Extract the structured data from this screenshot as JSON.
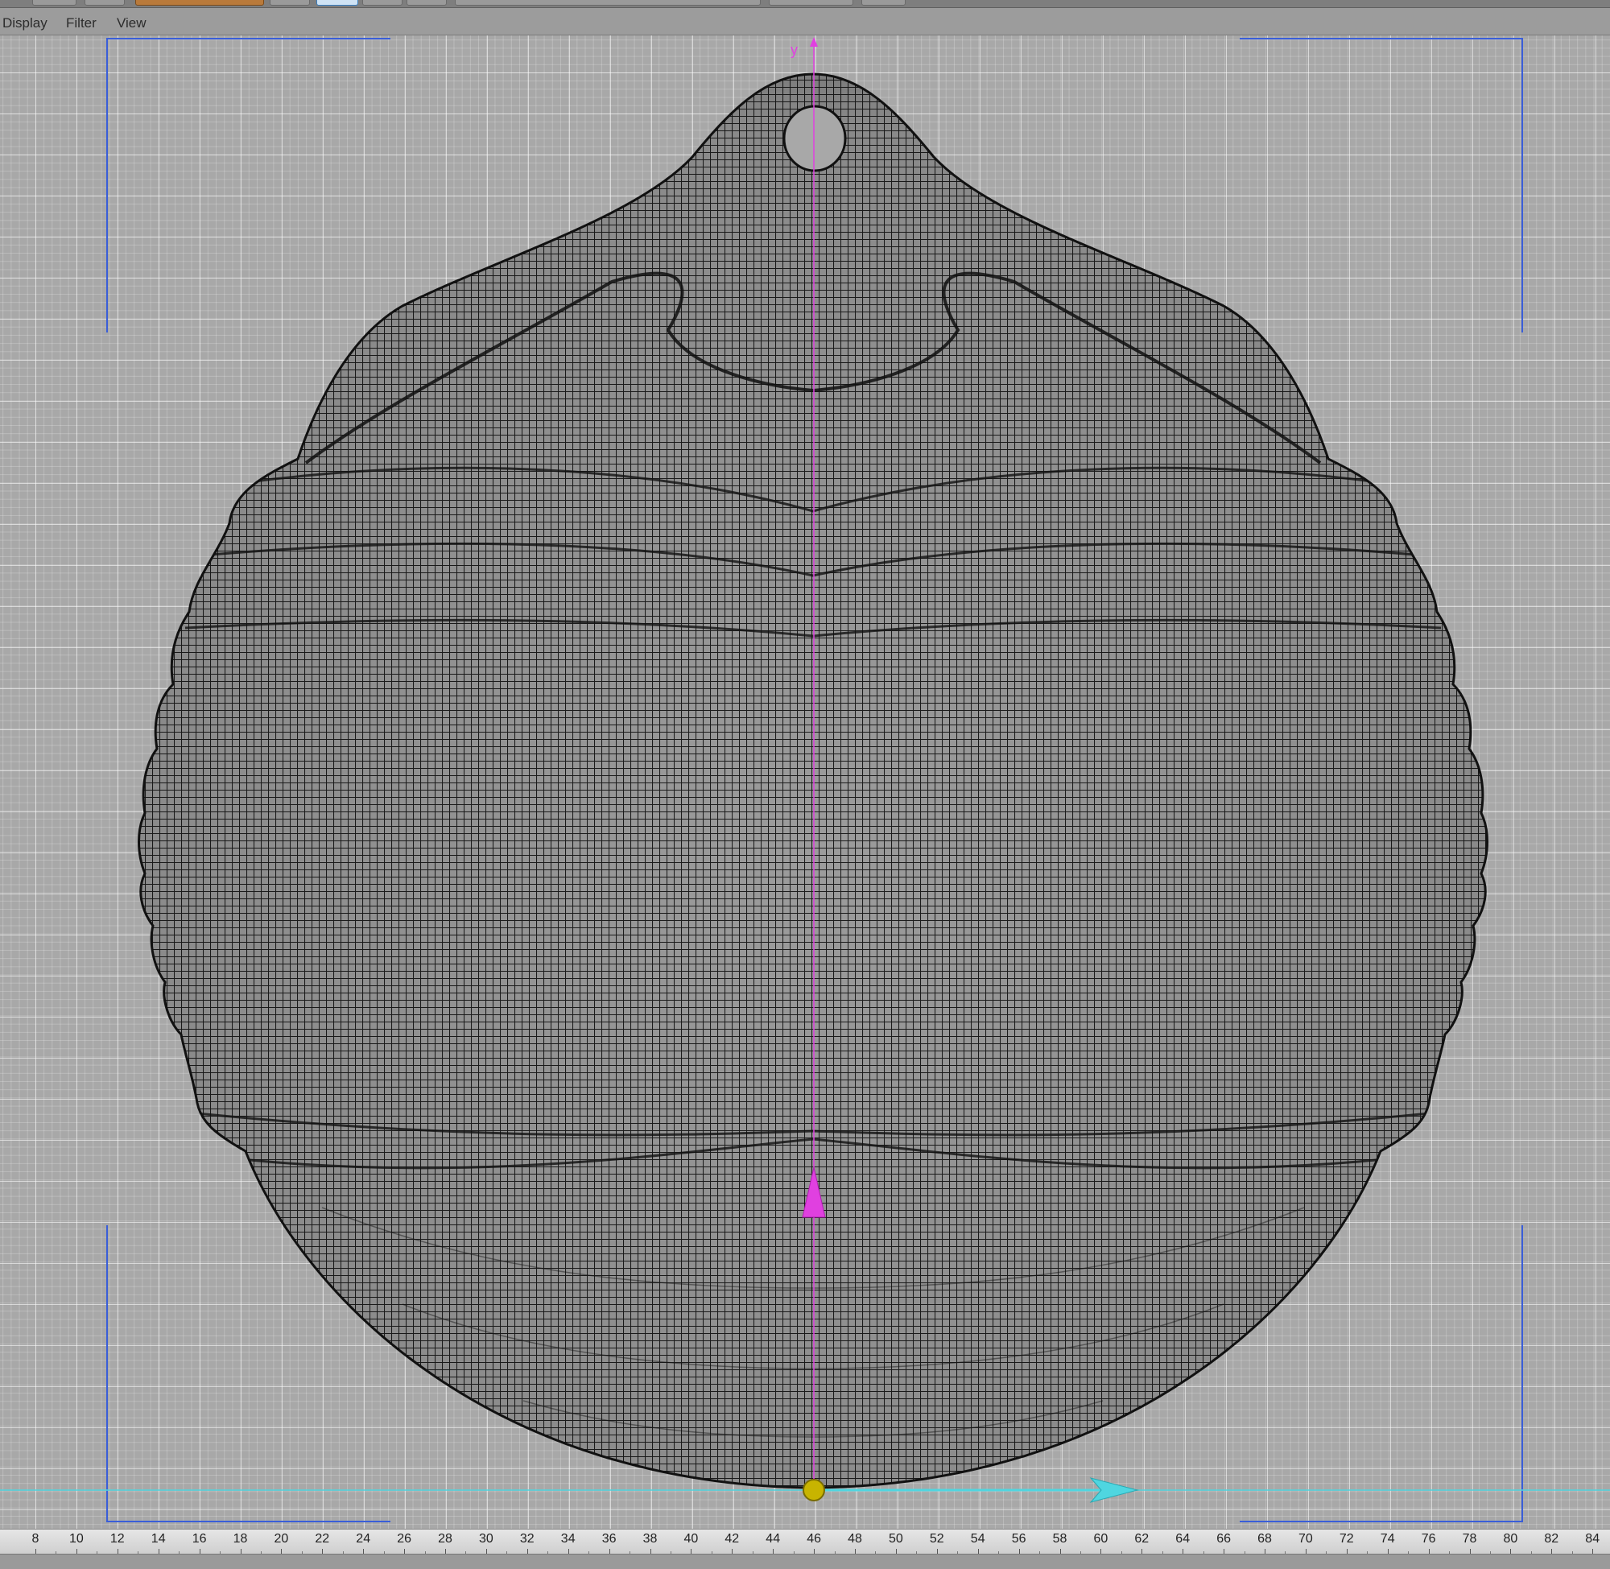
{
  "menu": {
    "items": [
      {
        "id": "display",
        "label": "Display"
      },
      {
        "id": "filter",
        "label": "Filter"
      },
      {
        "id": "view",
        "label": "View"
      }
    ]
  },
  "viewport": {
    "axis_label": "y",
    "colors": {
      "background": "#a8a8a8",
      "wireframe": "#1a1a1a",
      "camera_guides": "#3a5ed8",
      "y_axis": "#e040e0",
      "x_axis": "#4fd6e0",
      "pivot": "#c8b400"
    },
    "icons": [
      "y-axis-arrow-icon",
      "move-y-handle-icon",
      "move-x-handle-icon",
      "pivot-point-icon"
    ]
  },
  "ruler": {
    "labels": [
      "8",
      "10",
      "12",
      "14",
      "16",
      "18",
      "20",
      "22",
      "24",
      "26",
      "28",
      "30",
      "32",
      "34",
      "36",
      "38",
      "40",
      "42",
      "44",
      "46",
      "48",
      "50",
      "52",
      "54",
      "56",
      "58",
      "60",
      "62",
      "64",
      "66",
      "68",
      "70",
      "72",
      "74",
      "76",
      "78",
      "80",
      "82",
      "84"
    ]
  }
}
